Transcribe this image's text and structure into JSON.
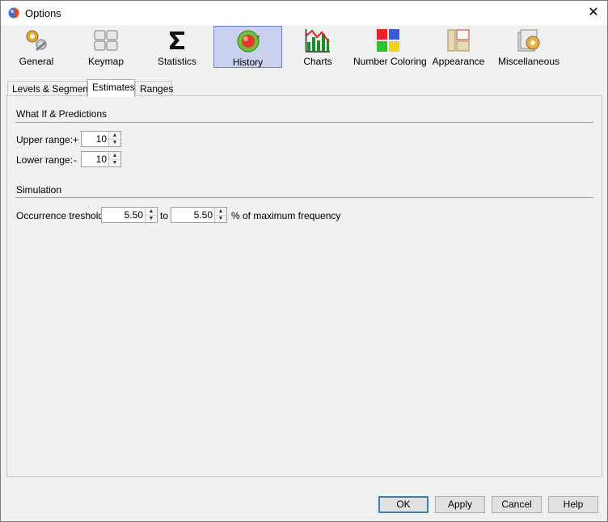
{
  "window": {
    "title": "Options",
    "close_glyph": "✕"
  },
  "toolbar": {
    "items": [
      {
        "label": "General",
        "icon": "gears-wrench-icon",
        "selected": false
      },
      {
        "label": "Keymap",
        "icon": "keyboard-keys-icon",
        "selected": false
      },
      {
        "label": "Statistics",
        "icon": "sigma-icon",
        "selected": false
      },
      {
        "label": "History",
        "icon": "history-refresh-icon",
        "selected": true
      },
      {
        "label": "Charts",
        "icon": "bar-chart-icon",
        "selected": false
      },
      {
        "label": "Number Coloring",
        "icon": "color-squares-icon",
        "selected": false
      },
      {
        "label": "Appearance",
        "icon": "appearance-layout-icon",
        "selected": false
      },
      {
        "label": "Miscellaneous",
        "icon": "miscellaneous-gear-icon",
        "selected": false
      }
    ]
  },
  "tabs": [
    {
      "label": "Levels & Segments",
      "active": false
    },
    {
      "label": "Estimates",
      "active": true
    },
    {
      "label": "Ranges",
      "active": false
    }
  ],
  "what_if": {
    "title": "What If & Predictions",
    "upper": {
      "label": "Upper range:",
      "sign": "+",
      "value": "10"
    },
    "lower": {
      "label": "Lower range:",
      "sign": "-",
      "value": "10"
    }
  },
  "simulation": {
    "title": "Simulation",
    "label": "Occurrence treshold:",
    "from_value": "5.50",
    "to_label": "to",
    "to_value": "5.50",
    "suffix": "% of maximum frequency"
  },
  "buttons": {
    "ok": "OK",
    "apply": "Apply",
    "cancel": "Cancel",
    "help": "Help"
  },
  "colors": {
    "selected_bg": "#c9d1ee",
    "selected_border": "#6f84c7",
    "default_button_border": "#3c7fb1"
  }
}
